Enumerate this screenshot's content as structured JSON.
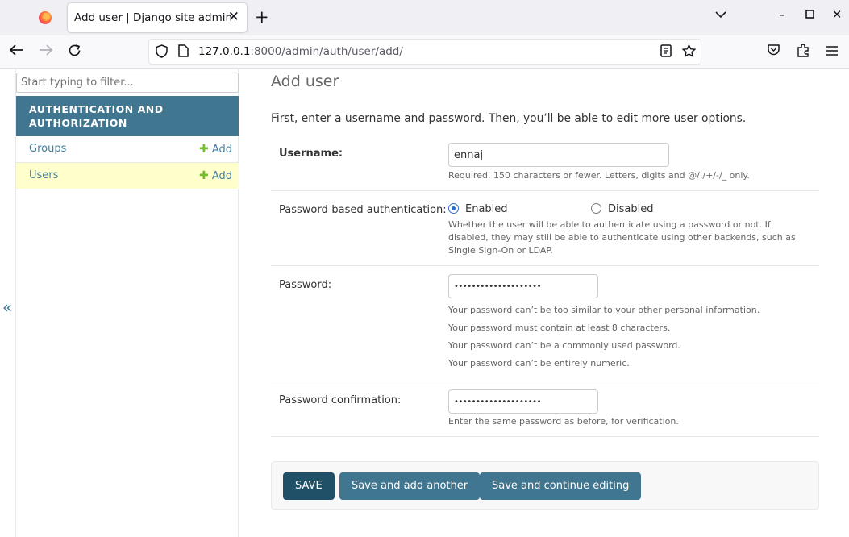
{
  "browser": {
    "tab_title": "Add user | Django site admin",
    "url_host": "127.0.0.1",
    "url_rest": ":8000/admin/auth/user/add/"
  },
  "sidebar": {
    "filter_placeholder": "Start typing to filter...",
    "collapse_label": "«",
    "module_title": "AUTHENTICATION AND AUTHORIZATION",
    "models": [
      {
        "name": "Groups",
        "add_label": "Add",
        "selected": false
      },
      {
        "name": "Users",
        "add_label": "Add",
        "selected": true
      }
    ]
  },
  "main": {
    "title": "Add user",
    "intro": "First, enter a username and password. Then, you’ll be able to edit more user options.",
    "username": {
      "label": "Username:",
      "value": "ennaj",
      "help": "Required. 150 characters or fewer. Letters, digits and @/./+/-/_ only."
    },
    "auth": {
      "label": "Password-based authentication:",
      "options": [
        {
          "label": "Enabled",
          "checked": true
        },
        {
          "label": "Disabled",
          "checked": false
        }
      ],
      "help": "Whether the user will be able to authenticate using a password or not. If disabled, they may still be able to authenticate using other backends, such as Single Sign-On or LDAP."
    },
    "password": {
      "label": "Password:",
      "value": "••••••••••••••••••••",
      "help": [
        "Your password can’t be too similar to your other personal information.",
        "Your password must contain at least 8 characters.",
        "Your password can’t be a commonly used password.",
        "Your password can’t be entirely numeric."
      ]
    },
    "password_confirm": {
      "label": "Password confirmation:",
      "value": "••••••••••••••••••••",
      "help": "Enter the same password as before, for verification."
    },
    "buttons": {
      "save": "SAVE",
      "save_add": "Save and add another",
      "save_continue": "Save and continue editing"
    }
  }
}
